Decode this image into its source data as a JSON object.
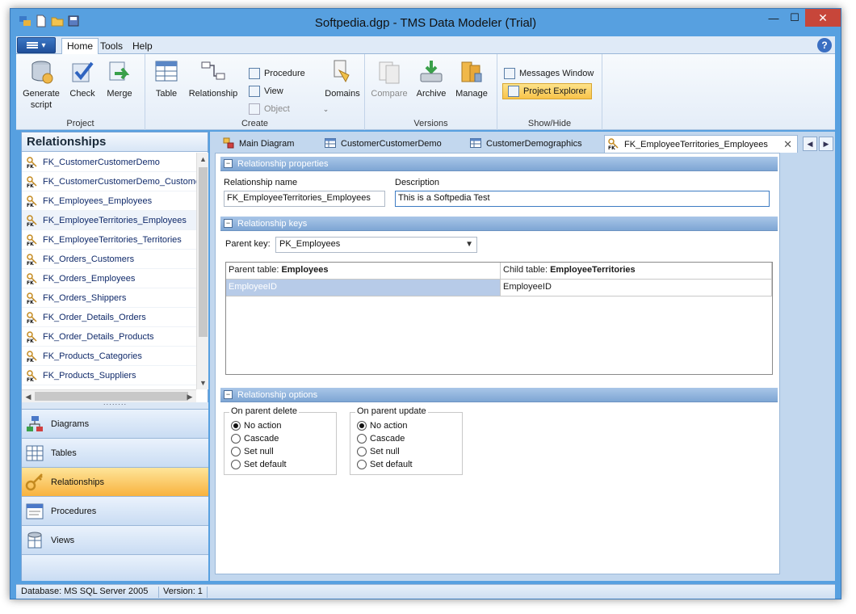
{
  "window": {
    "title": "Softpedia.dgp - TMS Data Modeler (Trial)",
    "minimize": "—",
    "maximize": "☐",
    "close": "✕"
  },
  "ribbon": {
    "app_menu": "▾",
    "tabs": [
      {
        "label": "Home",
        "active": true
      },
      {
        "label": "Tools",
        "active": false
      },
      {
        "label": "Help",
        "active": false
      }
    ],
    "help": "?",
    "groups": {
      "project": {
        "label": "Project",
        "generate": "Generate script",
        "check": "Check",
        "merge": "Merge"
      },
      "create": {
        "label": "Create",
        "table": "Table",
        "relationship": "Relationship",
        "procedure": "Procedure",
        "view": "View",
        "object": "Object",
        "domains": "Domains"
      },
      "versions": {
        "label": "Versions",
        "compare": "Compare",
        "archive": "Archive",
        "manage": "Manage"
      },
      "showhide": {
        "label": "Show/Hide",
        "messages": "Messages Window",
        "explorer": "Project Explorer"
      }
    }
  },
  "left_panel": {
    "title": "Relationships",
    "items": [
      "FK_CustomerCustomerDemo",
      "FK_CustomerCustomerDemo_Customer",
      "FK_Employees_Employees",
      "FK_EmployeeTerritories_Employees",
      "FK_EmployeeTerritories_Territories",
      "FK_Orders_Customers",
      "FK_Orders_Employees",
      "FK_Orders_Shippers",
      "FK_Order_Details_Orders",
      "FK_Order_Details_Products",
      "FK_Products_Categories",
      "FK_Products_Suppliers"
    ],
    "selected_index": 3,
    "splitter": "········",
    "nav": {
      "diagrams": "Diagrams",
      "tables": "Tables",
      "relationships": "Relationships",
      "procedures": "Procedures",
      "views": "Views"
    }
  },
  "doc_tabs": [
    {
      "label": "Main Diagram",
      "active": false
    },
    {
      "label": "CustomerCustomerDemo",
      "active": false
    },
    {
      "label": "CustomerDemographics",
      "active": false
    },
    {
      "label": "FK_EmployeeTerritories_Employees",
      "active": true
    }
  ],
  "tab_close": "✕",
  "editor": {
    "properties_header": "Relationship properties",
    "name_label": "Relationship name",
    "name_value": "FK_EmployeeTerritories_Employees",
    "description_label": "Description",
    "description_value": "This is a Softpedia Test",
    "keys_header": "Relationship keys",
    "parent_key_label": "Parent key:",
    "parent_key_value": "PK_Employees",
    "parent_table_prefix": "Parent table: ",
    "parent_table": "Employees",
    "child_table_prefix": "Child table: ",
    "child_table": "EmployeeTerritories",
    "parent_column": "EmployeeID",
    "child_column": "EmployeeID",
    "options_header": "Relationship options",
    "on_delete": {
      "title": "On parent delete",
      "options": [
        "No action",
        "Cascade",
        "Set null",
        "Set default"
      ],
      "selected": 0
    },
    "on_update": {
      "title": "On parent update",
      "options": [
        "No action",
        "Cascade",
        "Set null",
        "Set default"
      ],
      "selected": 0
    }
  },
  "statusbar": {
    "database": "Database: MS SQL Server 2005",
    "version": "Version: 1"
  }
}
